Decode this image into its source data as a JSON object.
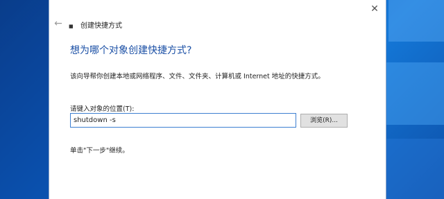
{
  "window": {
    "title": "创建快捷方式",
    "close_glyph": "✕",
    "back_glyph": "←",
    "icon_glyph": "■"
  },
  "content": {
    "heading": "想为哪个对象创建快捷方式?",
    "description": "该向导帮你创建本地或网络程序、文件、文件夹、计算机或 Internet 地址的快捷方式。",
    "location_label": "请键入对象的位置(T):",
    "location_value": "shutdown -s",
    "browse_label": "浏览(R)...",
    "hint": "单击\"下一步\"继续。"
  },
  "colors": {
    "heading": "#1a4fa5",
    "input_focus_border": "#3c7fd1",
    "desktop": "#0c5bbf"
  }
}
